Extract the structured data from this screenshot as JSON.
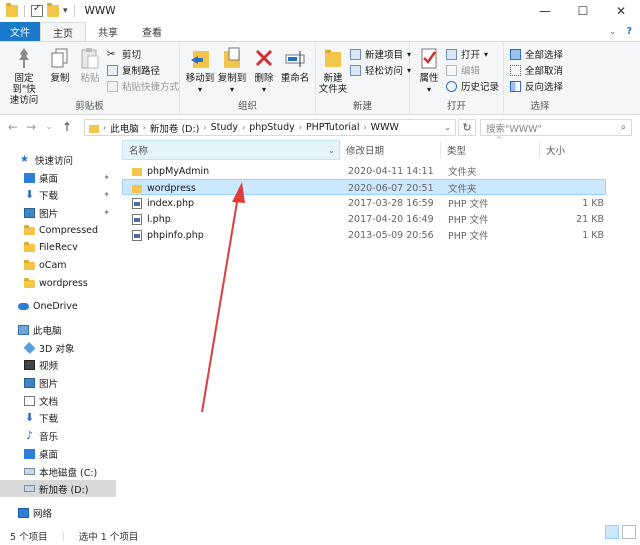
{
  "window": {
    "title": "WWW",
    "minimize": "—",
    "maximize": "☐",
    "close": "✕"
  },
  "tabs": {
    "file": "文件",
    "home": "主页",
    "share": "共享",
    "view": "查看",
    "collapse_icon": "chevron-down-icon",
    "help_icon": "?"
  },
  "ribbon": {
    "clipboard": {
      "label": "剪贴板",
      "pin": "固定到'快\n速访问",
      "pin_l1": "固定到\"快",
      "pin_l2": "速访问",
      "copy": "复制",
      "paste": "粘贴",
      "cut": "剪切",
      "copy_path": "复制路径",
      "paste_shortcut": "粘贴快捷方式"
    },
    "organize": {
      "label": "组织",
      "move_l1": "移动到",
      "copy_l1": "复制到",
      "delete": "删除",
      "rename": "重命名"
    },
    "new": {
      "label": "新建",
      "new_folder_l1": "新建",
      "new_folder_l2": "文件夹",
      "new_item": "新建项目",
      "easy_access": "轻松访问"
    },
    "open": {
      "label": "打开",
      "properties": "属性",
      "open": "打开",
      "edit": "编辑",
      "history": "历史记录"
    },
    "select": {
      "label": "选择",
      "select_all": "全部选择",
      "select_none": "全部取消",
      "invert": "反向选择"
    }
  },
  "address": {
    "back": "←",
    "forward": "→",
    "recent": "⌄",
    "up": "↑",
    "crumbs": [
      "此电脑",
      "新加卷 (D:)",
      "Study",
      "phpStudy",
      "PHPTutorial",
      "WWW"
    ],
    "refresh": "↻",
    "search_placeholder": "搜索\"WWW\"",
    "search_icon": "⌕"
  },
  "nav": {
    "quick_access": "快速访问",
    "desktop": "桌面",
    "downloads": "下载",
    "pictures": "图片",
    "compressed": "Compressed",
    "filerecv": "FileRecv",
    "ocam": "oCam",
    "wordpress": "wordpress",
    "onedrive": "OneDrive",
    "this_pc": "此电脑",
    "objects3d": "3D 对象",
    "videos": "视频",
    "pictures2": "图片",
    "documents": "文档",
    "downloads2": "下载",
    "music": "音乐",
    "desktop2": "桌面",
    "drive_c": "本地磁盘 (C:)",
    "drive_d": "新加卷 (D:)",
    "network": "网络",
    "pin": "📌"
  },
  "columns": {
    "name": "名称",
    "date": "修改日期",
    "type": "类型",
    "size": "大小"
  },
  "files": [
    {
      "name": "phpMyAdmin",
      "date": "2020-04-11 14:11",
      "type": "文件夹",
      "size": "",
      "icon": "folder-icon"
    },
    {
      "name": "wordpress",
      "date": "2020-06-07 20:51",
      "type": "文件夹",
      "size": "",
      "icon": "folder-icon"
    },
    {
      "name": "index.php",
      "date": "2017-03-28 16:59",
      "type": "PHP 文件",
      "size": "1 KB",
      "icon": "php-file-icon"
    },
    {
      "name": "l.php",
      "date": "2017-04-20 16:49",
      "type": "PHP 文件",
      "size": "21 KB",
      "icon": "php-file-icon"
    },
    {
      "name": "phpinfo.php",
      "date": "2013-05-09 20:56",
      "type": "PHP 文件",
      "size": "1 KB",
      "icon": "php-file-icon"
    }
  ],
  "status": {
    "count": "5 个项目",
    "selected": "选中 1 个项目"
  },
  "colors": {
    "accent": "#1979ca",
    "selection": "#cce8ff",
    "annotation_arrow": "#e03a3a"
  }
}
